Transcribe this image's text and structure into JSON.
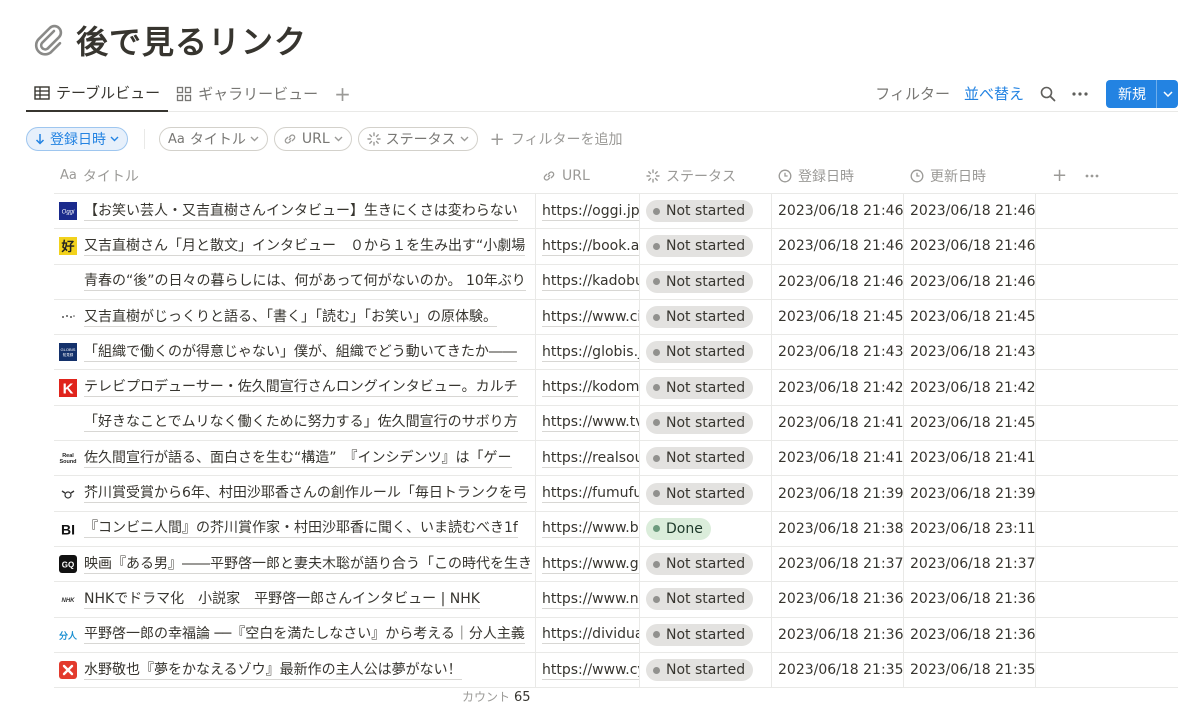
{
  "page": {
    "title": "後で見るリンク",
    "icon": "paperclip-icon"
  },
  "views": {
    "tabs": [
      {
        "label": "テーブルビュー",
        "icon": "table-icon",
        "active": true
      },
      {
        "label": "ギャラリービュー",
        "icon": "gallery-icon",
        "active": false
      }
    ],
    "filter_label": "フィルター",
    "sort_label": "並べ替え",
    "new_label": "新規"
  },
  "filters": {
    "sort_chip": "登録日時",
    "chips": [
      "タイトル",
      "URL",
      "ステータス"
    ],
    "add_filter": "フィルターを追加"
  },
  "columns": {
    "title": "タイトル",
    "title_prefix": "Aa",
    "url": "URL",
    "status": "ステータス",
    "created": "登録日時",
    "updated": "更新日時"
  },
  "rows": [
    {
      "favicon": "oggi",
      "title": "【お笑い芸人・又吉直樹さんインタビュー】生きにくさは変わらない",
      "url": "https://oggi.jp/",
      "status": "Not started",
      "created": "2023/06/18 21:46",
      "updated": "2023/06/18 21:46"
    },
    {
      "favicon": "book",
      "title": "又吉直樹さん「月と散文」インタビュー　０から１を生み出す“小劇場",
      "url": "https://book.asa",
      "status": "Not started",
      "created": "2023/06/18 21:46",
      "updated": "2023/06/18 21:46"
    },
    {
      "favicon": "none",
      "title": "青春の“後”の日々の暮らしには、何があって何がないのか。 10年ぶり",
      "url": "https://kadobun",
      "status": "Not started",
      "created": "2023/06/18 21:46",
      "updated": "2023/06/18 21:46"
    },
    {
      "favicon": "dots",
      "title": "又吉直樹がじっくりと語る、「書く」「読む」「お笑い」の原体験。",
      "url": "https://www.cin",
      "status": "Not started",
      "created": "2023/06/18 21:45",
      "updated": "2023/06/18 21:45"
    },
    {
      "favicon": "globis",
      "title": "「組織で働くのが得意じゃない」僕が、組織でどう動いてきたか――",
      "url": "https://globis.jp",
      "status": "Not started",
      "created": "2023/06/18 21:43",
      "updated": "2023/06/18 21:43"
    },
    {
      "favicon": "k",
      "title": "テレビプロデューサー・佐久間宣行さんロングインタビュー。カルチ",
      "url": "https://kodomo",
      "status": "Not started",
      "created": "2023/06/18 21:42",
      "updated": "2023/06/18 21:42"
    },
    {
      "favicon": "none",
      "title": "「好きなことでムリなく働くために努力する」佐久間宣行のサボり方",
      "url": "https://www.tv",
      "status": "Not started",
      "created": "2023/06/18 21:41",
      "updated": "2023/06/18 21:45"
    },
    {
      "favicon": "realsound",
      "title": "佐久間宣行が語る、面白さを生む“構造”　『インシデンツ』は「ゲー",
      "url": "https://realsou",
      "status": "Not started",
      "created": "2023/06/18 21:41",
      "updated": "2023/06/18 21:41"
    },
    {
      "favicon": "fumufu",
      "title": "芥川賞受賞から6年、村田沙耶香さんの創作ルール「毎日トランクを弓",
      "url": "https://fumufu",
      "status": "Not started",
      "created": "2023/06/18 21:39",
      "updated": "2023/06/18 21:39"
    },
    {
      "favicon": "bi",
      "title": "『コンビニ人間』の芥川賞作家・村田沙耶香に聞く、いま読むべき1f",
      "url": "https://www.bu",
      "status": "Done",
      "created": "2023/06/18 21:38",
      "updated": "2023/06/18 23:11"
    },
    {
      "favicon": "gq",
      "title": "映画『ある男』――平野啓一郎と妻夫木聡が語り合う「この時代を生き",
      "url": "https://www.gq",
      "status": "Not started",
      "created": "2023/06/18 21:37",
      "updated": "2023/06/18 21:37"
    },
    {
      "favicon": "nhk",
      "title": "NHKでドラマ化　小説家　平野啓一郎さんインタビュー | NHK",
      "url": "https://www.nh",
      "status": "Not started",
      "created": "2023/06/18 21:36",
      "updated": "2023/06/18 21:36"
    },
    {
      "favicon": "bunjin",
      "title": "平野啓一郎の幸福論 ──『空白を満たしなさい』から考える｜分人主義",
      "url": "https://dividua",
      "status": "Not started",
      "created": "2023/06/18 21:36",
      "updated": "2023/06/18 21:36"
    },
    {
      "favicon": "cy",
      "title": "水野敬也『夢をかなえるゾウ』最新作の主人公は夢がない！",
      "url": "https://www.cy",
      "status": "Not started",
      "created": "2023/06/18 21:35",
      "updated": "2023/06/18 21:35"
    }
  ],
  "favicon_text": {
    "oggi": "Oggi",
    "book": "好",
    "dots": "·:·",
    "globis": "GLOBIS",
    "k": "K",
    "realsound": "Real Sound",
    "bi": "BI",
    "gq": "GQ",
    "nhk": "NHK",
    "bunjin": "分人"
  },
  "footer": {
    "label": "カウント",
    "count": "65"
  },
  "colors": {
    "accent": "#2383e2",
    "done_bg": "#dbeddb",
    "not_started_bg": "#e3e2e0"
  }
}
